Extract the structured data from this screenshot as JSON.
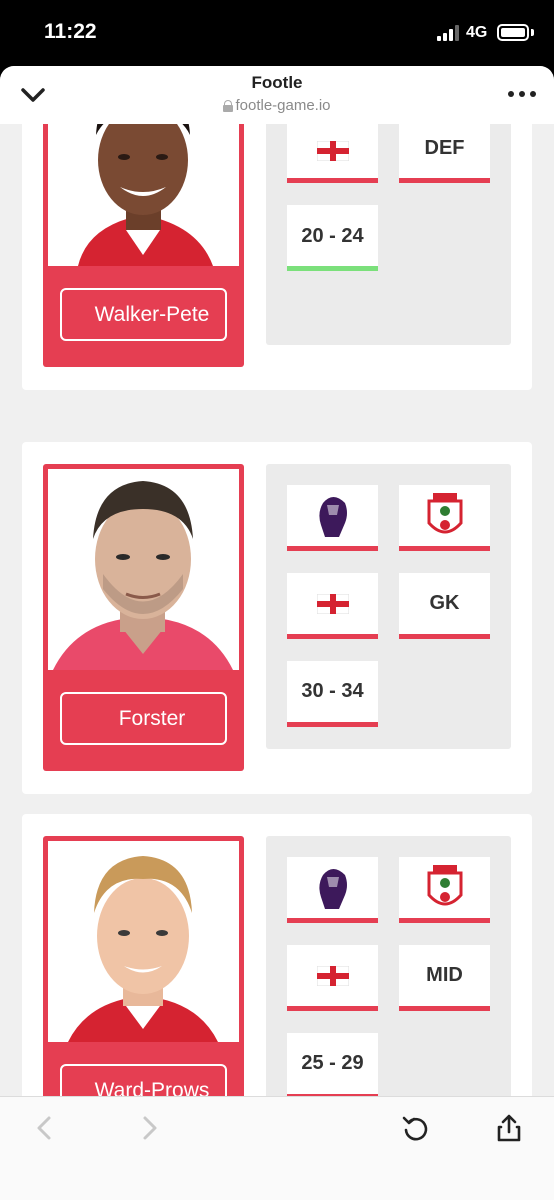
{
  "status_bar": {
    "time": "11:22",
    "network": "4G"
  },
  "browser": {
    "title": "Footle",
    "url": "footle-game.io"
  },
  "cards": [
    {
      "name": "Walker-Pete",
      "league_icon": "premier-league-icon",
      "club_icon": "southampton-crest-icon",
      "nation_flag": "🏴󠁧󠁢󠁥󠁮󠁧󠁿",
      "position": "DEF",
      "age_range": "20 - 24",
      "age_correct": true
    },
    {
      "name": "Forster",
      "league_icon": "premier-league-icon",
      "club_icon": "southampton-crest-icon",
      "nation_flag": "🏴󠁧󠁢󠁥󠁮󠁧󠁿",
      "position": "GK",
      "age_range": "30 - 34",
      "age_correct": false
    },
    {
      "name": "Ward-Prows",
      "league_icon": "premier-league-icon",
      "club_icon": "southampton-crest-icon",
      "nation_flag": "🏴󠁧󠁢󠁥󠁮󠁧󠁿",
      "position": "MID",
      "age_range": "25 - 29",
      "age_correct": false
    }
  ],
  "colors": {
    "accent": "#e53e52",
    "correct": "#7be07b",
    "panel": "#ebebeb",
    "page": "#f0f0f0"
  }
}
